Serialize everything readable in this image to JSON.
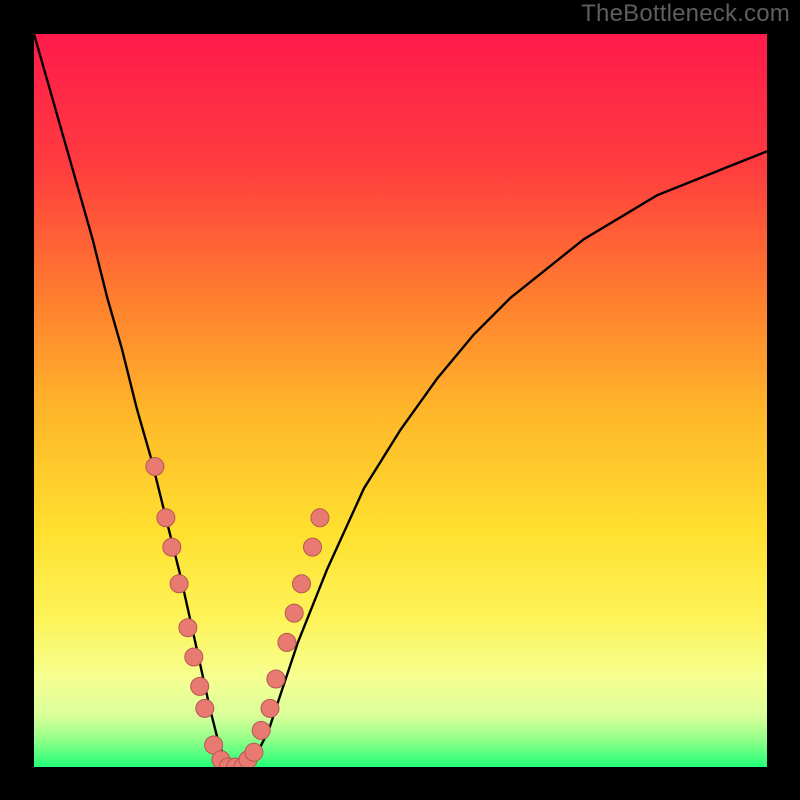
{
  "watermark": "TheBottleneck.com",
  "colors": {
    "frame_bg": "#000000",
    "gradient_stops": [
      {
        "offset": 0.0,
        "color": "#ff1a4b"
      },
      {
        "offset": 0.18,
        "color": "#ff3c3f"
      },
      {
        "offset": 0.35,
        "color": "#ff7a2f"
      },
      {
        "offset": 0.52,
        "color": "#ffb82a"
      },
      {
        "offset": 0.68,
        "color": "#ffe02f"
      },
      {
        "offset": 0.8,
        "color": "#fdf45a"
      },
      {
        "offset": 0.88,
        "color": "#f6ff92"
      },
      {
        "offset": 0.93,
        "color": "#d9ff9a"
      },
      {
        "offset": 0.96,
        "color": "#99ff8a"
      },
      {
        "offset": 1.0,
        "color": "#22ff77"
      }
    ],
    "curve": "#000000",
    "marker_fill": "#e87a72",
    "marker_stroke": "#b55850"
  },
  "chart_data": {
    "type": "line",
    "title": "",
    "xlabel": "",
    "ylabel": "",
    "xlim": [
      0,
      100
    ],
    "ylim": [
      0,
      100
    ],
    "note": "x in [0,100] maps left→right; y is the curve height in percent of plot area (0=bottom, 100=top). Values are estimated from pixel positions of the rendered curve.",
    "curve": {
      "name": "bottleneck-curve",
      "x": [
        0,
        2,
        4,
        6,
        8,
        10,
        12,
        14,
        16,
        18,
        20,
        22,
        24,
        25,
        26,
        27,
        28,
        29,
        30,
        32,
        34,
        36,
        40,
        45,
        50,
        55,
        60,
        65,
        70,
        75,
        80,
        85,
        90,
        95,
        100
      ],
      "y": [
        100,
        93,
        86,
        79,
        72,
        64,
        57,
        49,
        42,
        34,
        26,
        17,
        8,
        4,
        1,
        0,
        0,
        0,
        1,
        5,
        11,
        17,
        27,
        38,
        46,
        53,
        59,
        64,
        68,
        72,
        75,
        78,
        80,
        82,
        84
      ]
    },
    "markers": {
      "name": "highlight-points",
      "note": "salmon dots overlaid on the curve near the valley",
      "points": [
        {
          "x": 16.5,
          "y": 41
        },
        {
          "x": 18.0,
          "y": 34
        },
        {
          "x": 18.8,
          "y": 30
        },
        {
          "x": 19.8,
          "y": 25
        },
        {
          "x": 21.0,
          "y": 19
        },
        {
          "x": 21.8,
          "y": 15
        },
        {
          "x": 22.6,
          "y": 11
        },
        {
          "x": 23.3,
          "y": 8
        },
        {
          "x": 24.5,
          "y": 3
        },
        {
          "x": 25.5,
          "y": 1
        },
        {
          "x": 26.5,
          "y": 0
        },
        {
          "x": 27.5,
          "y": 0
        },
        {
          "x": 28.5,
          "y": 0
        },
        {
          "x": 29.2,
          "y": 1
        },
        {
          "x": 30.0,
          "y": 2
        },
        {
          "x": 31.0,
          "y": 5
        },
        {
          "x": 32.2,
          "y": 8
        },
        {
          "x": 33.0,
          "y": 12
        },
        {
          "x": 34.5,
          "y": 17
        },
        {
          "x": 35.5,
          "y": 21
        },
        {
          "x": 36.5,
          "y": 25
        },
        {
          "x": 38.0,
          "y": 30
        },
        {
          "x": 39.0,
          "y": 34
        }
      ]
    }
  }
}
